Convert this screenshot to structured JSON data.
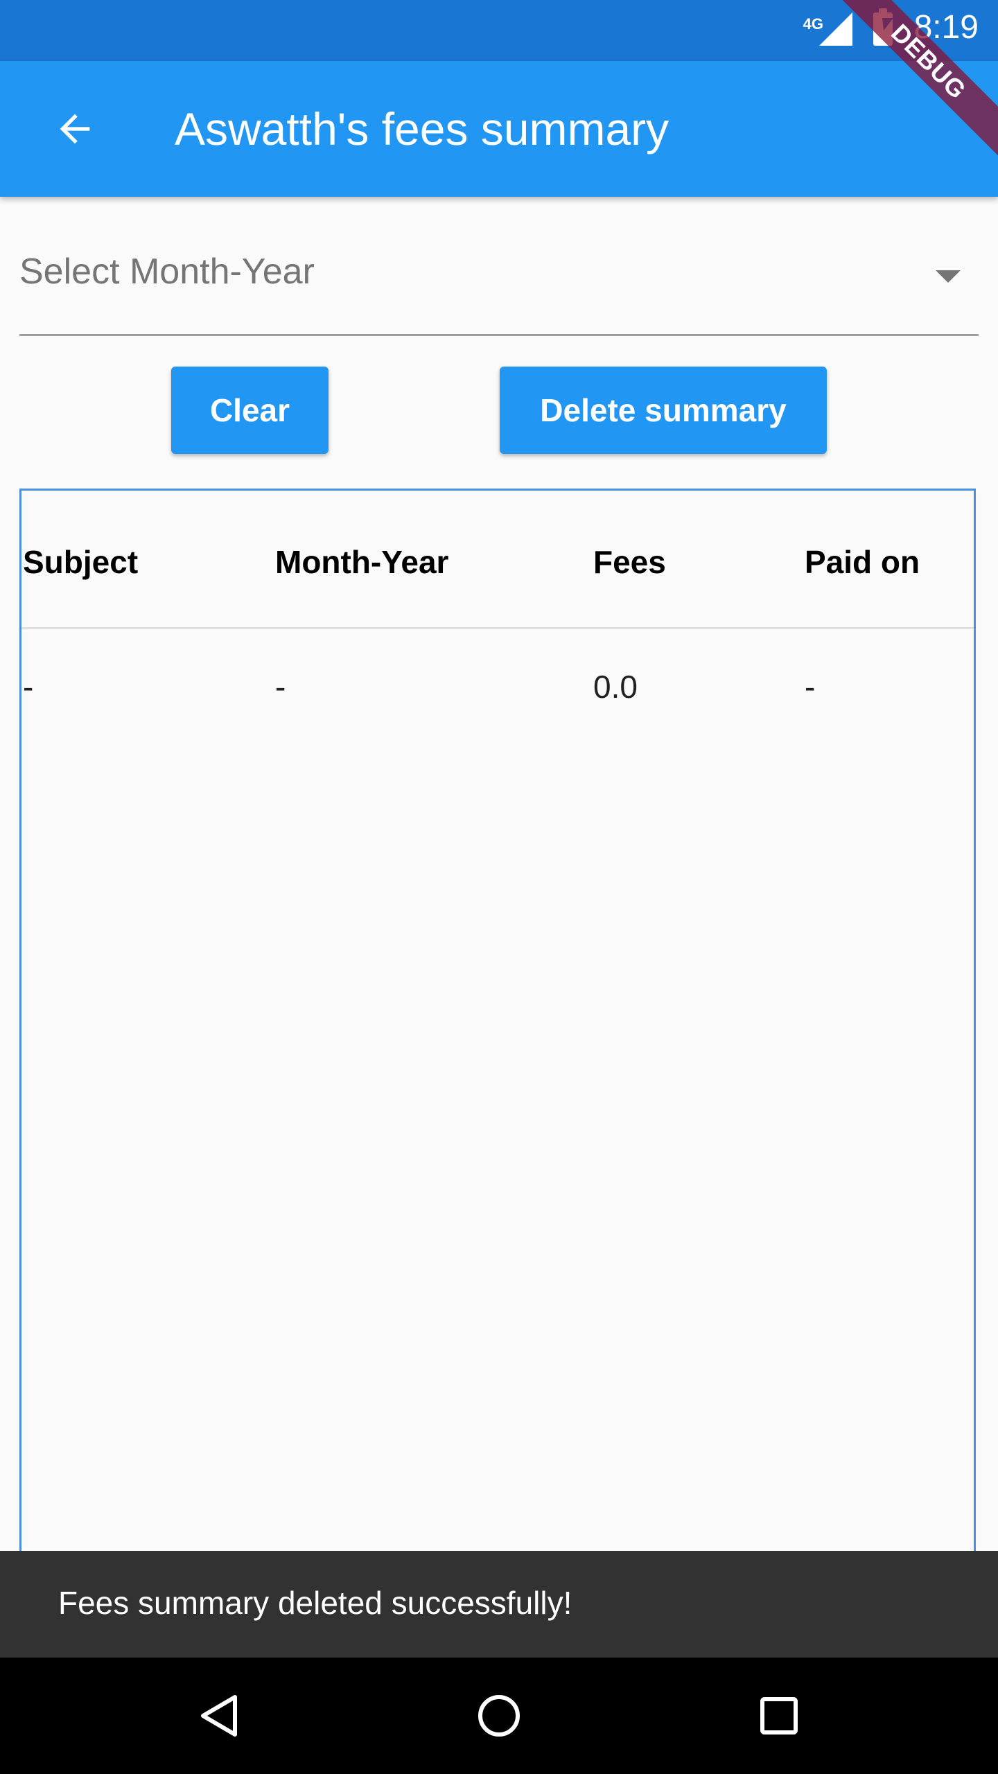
{
  "status_bar": {
    "network": "4G",
    "time": "8:19",
    "icons": [
      "signal-icon",
      "battery-charging-icon"
    ]
  },
  "debug_banner": "DEBUG",
  "app_bar": {
    "title": "Aswatth's fees summary",
    "back_icon": "arrow-back-icon"
  },
  "month_dropdown": {
    "hint": "Select Month-Year",
    "icon": "dropdown-arrow-icon"
  },
  "buttons": {
    "clear": "Clear",
    "delete_summary": "Delete summary"
  },
  "table": {
    "columns": [
      "Subject",
      "Month-Year",
      "Fees",
      "Paid on"
    ],
    "rows": [
      [
        "-",
        "-",
        "0.0",
        "-"
      ]
    ]
  },
  "snackbar": {
    "message": "Fees summary deleted successfully!"
  },
  "nav_bar": {
    "icons": [
      "nav-back-icon",
      "nav-home-icon",
      "nav-recents-icon"
    ]
  },
  "colors": {
    "primary": "#2196F3",
    "primary_dark": "#1976D2",
    "table_border": "#4A90E2",
    "snackbar_bg": "#323232",
    "debug_ribbon": "#881133"
  }
}
